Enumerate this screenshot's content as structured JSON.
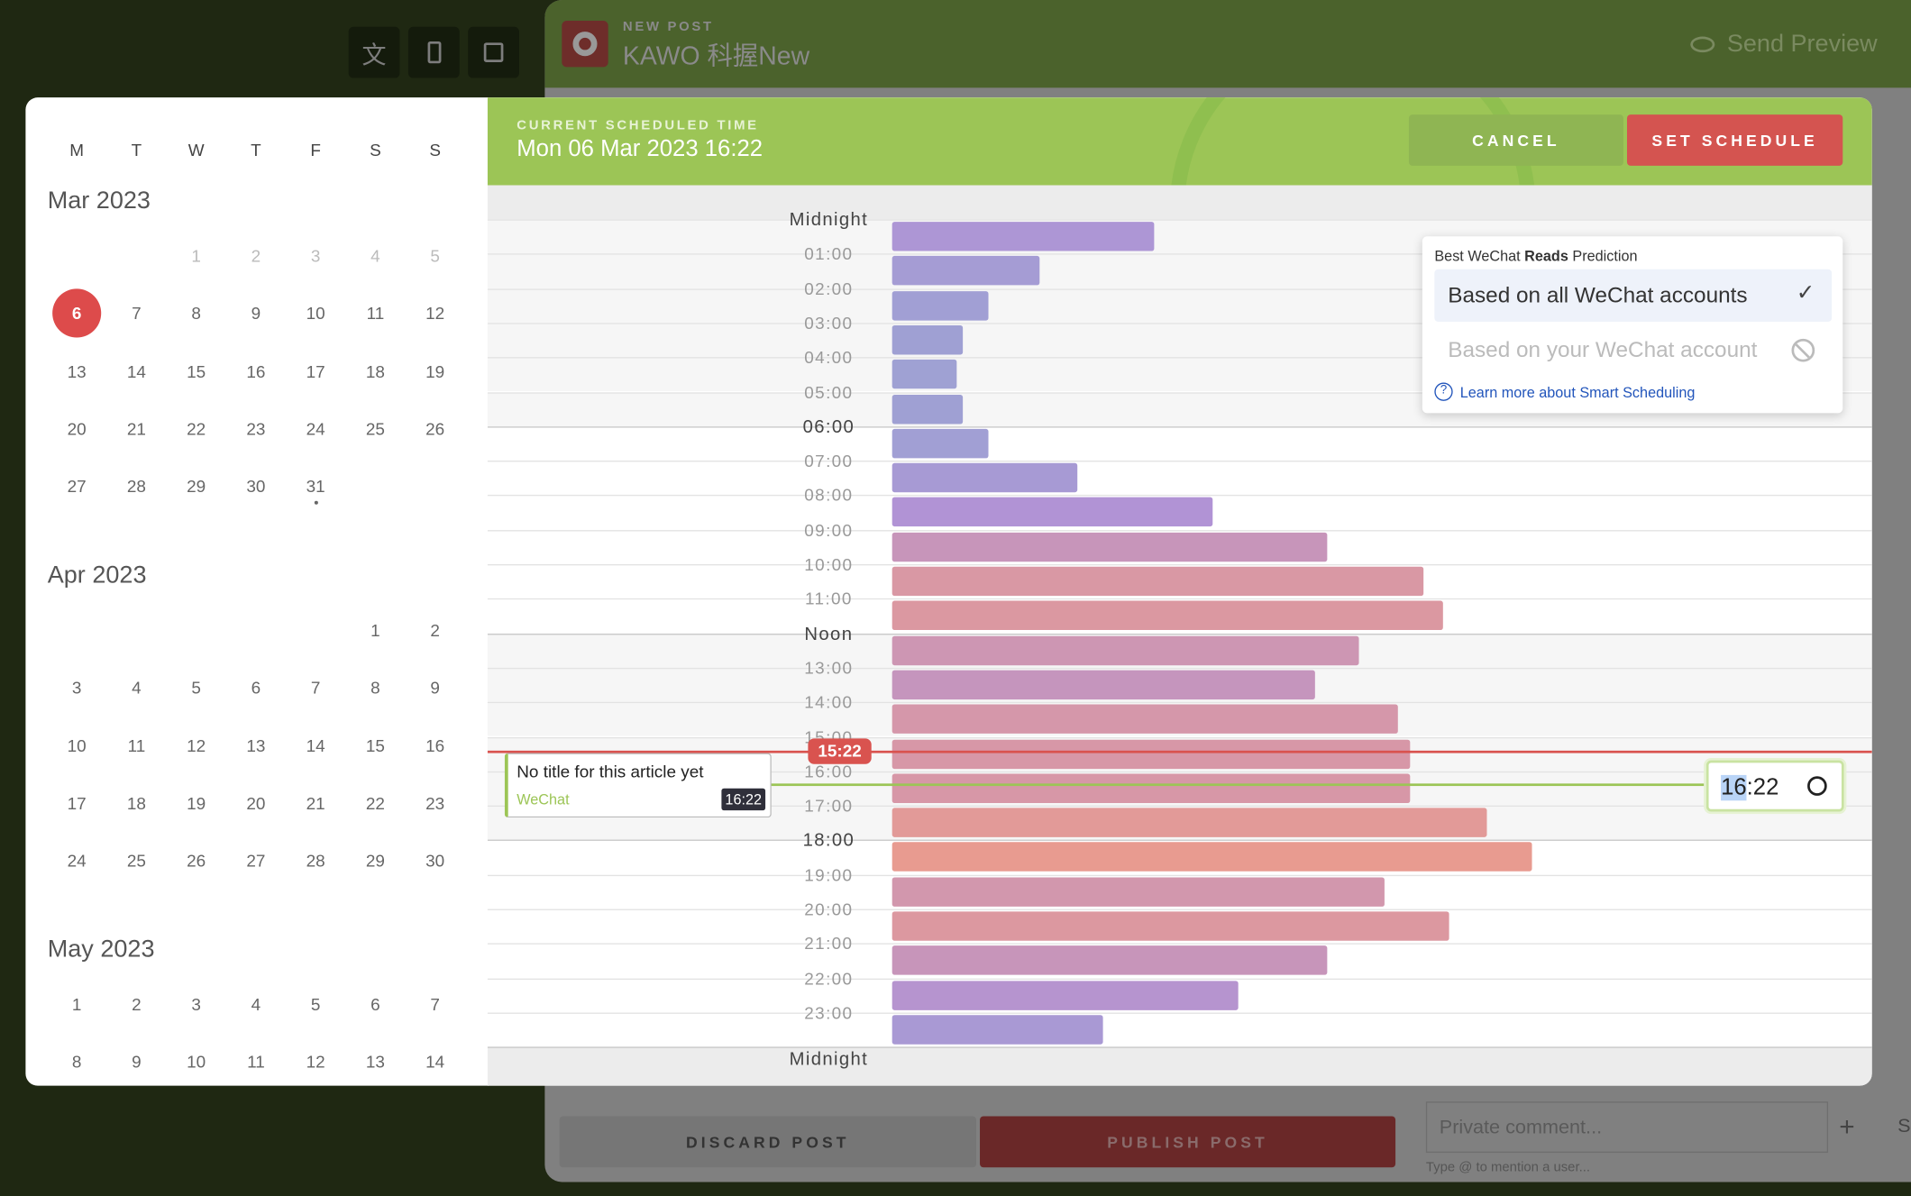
{
  "toolbar": {
    "icons": [
      "translate-icon",
      "mobile-icon",
      "image-icon"
    ]
  },
  "app": {
    "subtitle": "NEW POST",
    "title": "KAWO 科握New",
    "send_preview": "Send Preview",
    "discard": "DISCARD POST",
    "publish": "PUBLISH POST",
    "comment_placeholder": "Private comment...",
    "comment_hint": "Type @ to mention a user...",
    "add": "+",
    "send": "S"
  },
  "calendar": {
    "weekdays": [
      "M",
      "T",
      "W",
      "T",
      "F",
      "S",
      "S"
    ],
    "months": [
      {
        "label": "Mar 2023",
        "offset": 2,
        "days": 31,
        "past_until": 5,
        "selected": 6,
        "dot": 31
      },
      {
        "label": "Apr 2023",
        "offset": 5,
        "days": 30
      },
      {
        "label": "May 2023",
        "offset": 0,
        "days": 14
      }
    ]
  },
  "schedule": {
    "header_label": "CURRENT SCHEDULED TIME",
    "current": "Mon 06 Mar 2023 16:22",
    "cancel": "CANCEL",
    "set": "SET SCHEDULE",
    "now_badge": "15:22",
    "time_input": "16:22",
    "time_selected_part": "16"
  },
  "post": {
    "title": "No title for this article yet",
    "channel": "WeChat",
    "time": "16:22"
  },
  "prediction": {
    "title_pre": "Best WeChat ",
    "title_bold": "Reads",
    "title_post": " Prediction",
    "option_all": "Based on all WeChat accounts",
    "option_yours": "Based on your WeChat account",
    "learn_more": "Learn more about Smart Scheduling",
    "selected": "all"
  },
  "chart_data": {
    "type": "bar",
    "orientation": "horizontal",
    "categories": [
      "Midnight",
      "01:00",
      "02:00",
      "03:00",
      "04:00",
      "05:00",
      "06:00",
      "07:00",
      "08:00",
      "09:00",
      "10:00",
      "11:00",
      "Noon",
      "13:00",
      "14:00",
      "15:00",
      "16:00",
      "17:00",
      "18:00",
      "19:00",
      "20:00",
      "21:00",
      "22:00",
      "23:00"
    ],
    "end_label": "Midnight",
    "values": [
      41,
      23,
      15,
      11,
      10,
      11,
      15,
      29,
      50,
      68,
      83,
      86,
      73,
      66,
      79,
      81,
      81,
      93,
      100,
      77,
      87,
      68,
      54,
      33
    ],
    "value_scale": "relative (max = 100)",
    "colors": {
      "low": "#9aa4d3",
      "mid": "#b193d5",
      "high": "#d697a8",
      "peak": "#e89b90"
    }
  }
}
